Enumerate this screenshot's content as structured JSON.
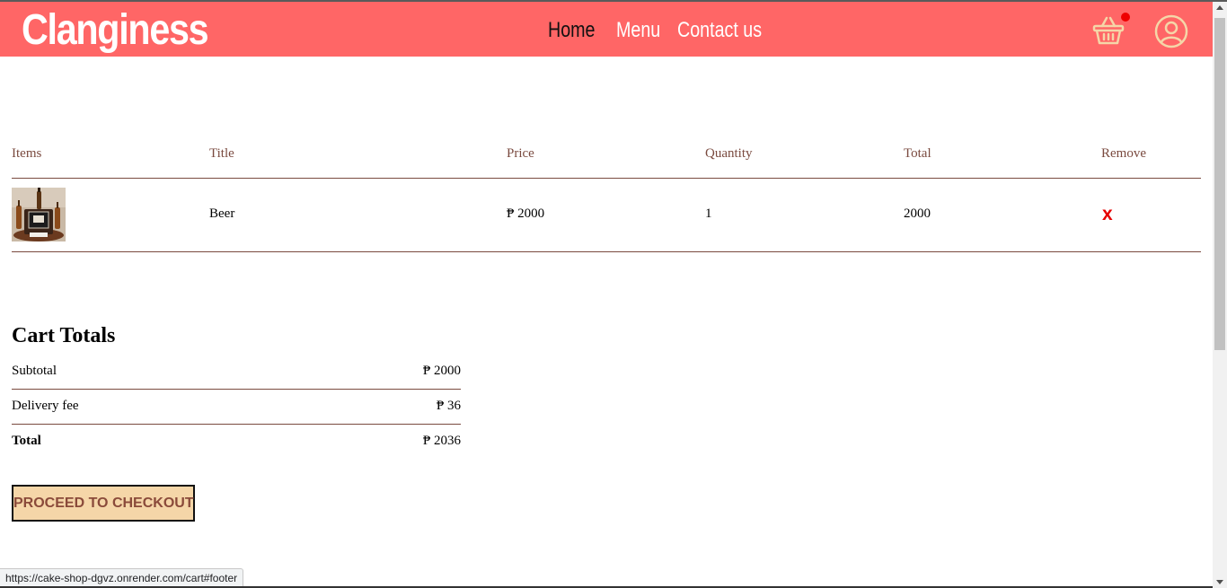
{
  "header": {
    "logo": "Clanginess",
    "nav": [
      "Home",
      "Menu",
      "Contact us"
    ],
    "active_nav": "Home",
    "basket_icon": "basket-icon",
    "profile_icon": "profile-icon",
    "accent_color": "#ff6666"
  },
  "cart": {
    "columns": [
      "Items",
      "Title",
      "Price",
      "Quantity",
      "Total",
      "Remove"
    ],
    "rows": [
      {
        "image": "beer-cake-thumbnail",
        "title": "Beer",
        "price": "₱ 2000",
        "quantity": "1",
        "total": "2000",
        "remove": "x"
      }
    ]
  },
  "totals": {
    "heading": "Cart Totals",
    "subtotal_label": "Subtotal",
    "subtotal_value": "₱ 2000",
    "delivery_label": "Delivery fee",
    "delivery_value": "₱ 36",
    "total_label": "Total",
    "total_value": "₱ 2036",
    "checkout_label": "PROCEED TO CHECKOUT"
  },
  "status_bar": {
    "url": "https://cake-shop-dgvz.onrender.com/cart#footer"
  }
}
